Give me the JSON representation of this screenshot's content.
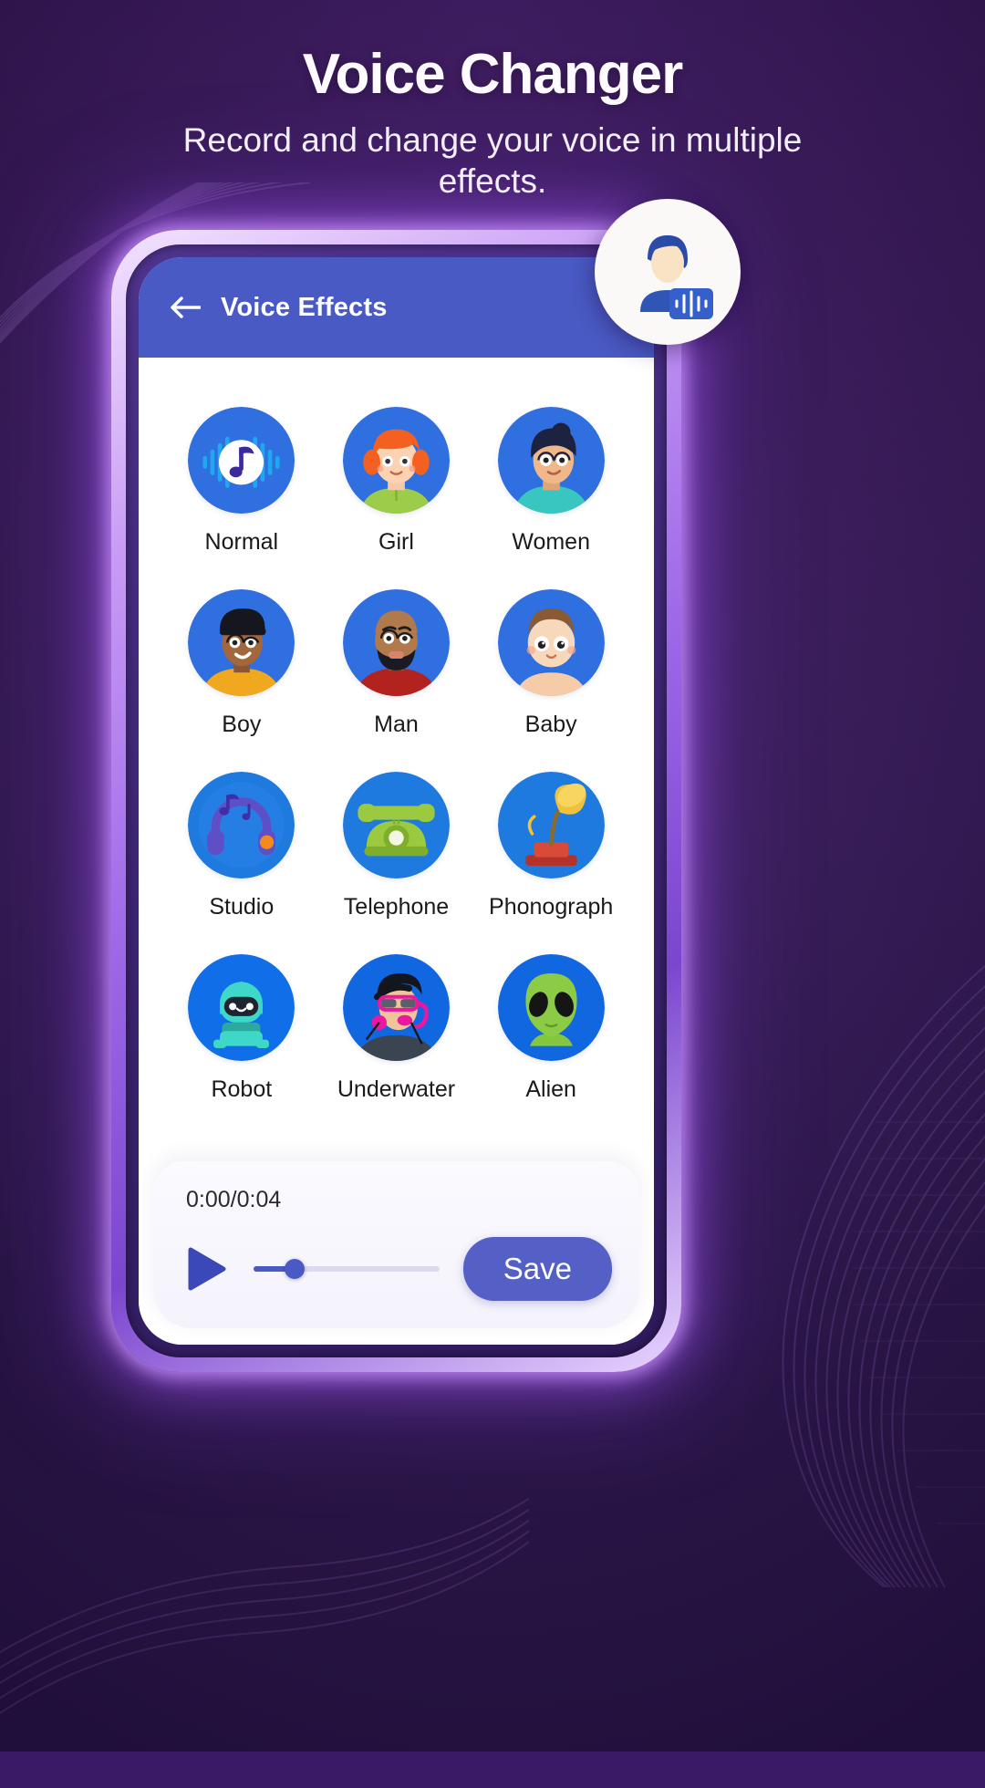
{
  "header": {
    "title": "Voice Changer",
    "subtitle": "Record and change your voice in multiple effects."
  },
  "colors": {
    "background_top": "#4a1f75",
    "background_bottom": "#2e1552",
    "appbar": "#4a5ac4",
    "accent": "#5460c6",
    "avatar_blue": "#2f6fe0",
    "phone_glow": "#c89cf5",
    "label_text": "#1a1a1a"
  },
  "logo_badge": {
    "icon": "person-soundwave-icon"
  },
  "appbar": {
    "back_icon": "arrow-left-icon",
    "title": "Voice Effects"
  },
  "effects": [
    {
      "label": "Normal",
      "icon": "normal-waveform-icon"
    },
    {
      "label": "Girl",
      "icon": "girl-avatar-icon"
    },
    {
      "label": "Women",
      "icon": "women-avatar-icon"
    },
    {
      "label": "Boy",
      "icon": "boy-avatar-icon"
    },
    {
      "label": "Man",
      "icon": "man-avatar-icon"
    },
    {
      "label": "Baby",
      "icon": "baby-avatar-icon"
    },
    {
      "label": "Studio",
      "icon": "studio-headphones-icon"
    },
    {
      "label": "Telephone",
      "icon": "telephone-icon"
    },
    {
      "label": "Phonograph",
      "icon": "phonograph-icon"
    },
    {
      "label": "Robot",
      "icon": "robot-icon"
    },
    {
      "label": "Underwater",
      "icon": "underwater-diver-icon"
    },
    {
      "label": "Alien",
      "icon": "alien-icon"
    }
  ],
  "player": {
    "time": "0:00/0:04",
    "current_time": "0:00",
    "total_time": "0:04",
    "play_icon": "play-icon",
    "progress_percent": 22,
    "save_label": "Save"
  }
}
